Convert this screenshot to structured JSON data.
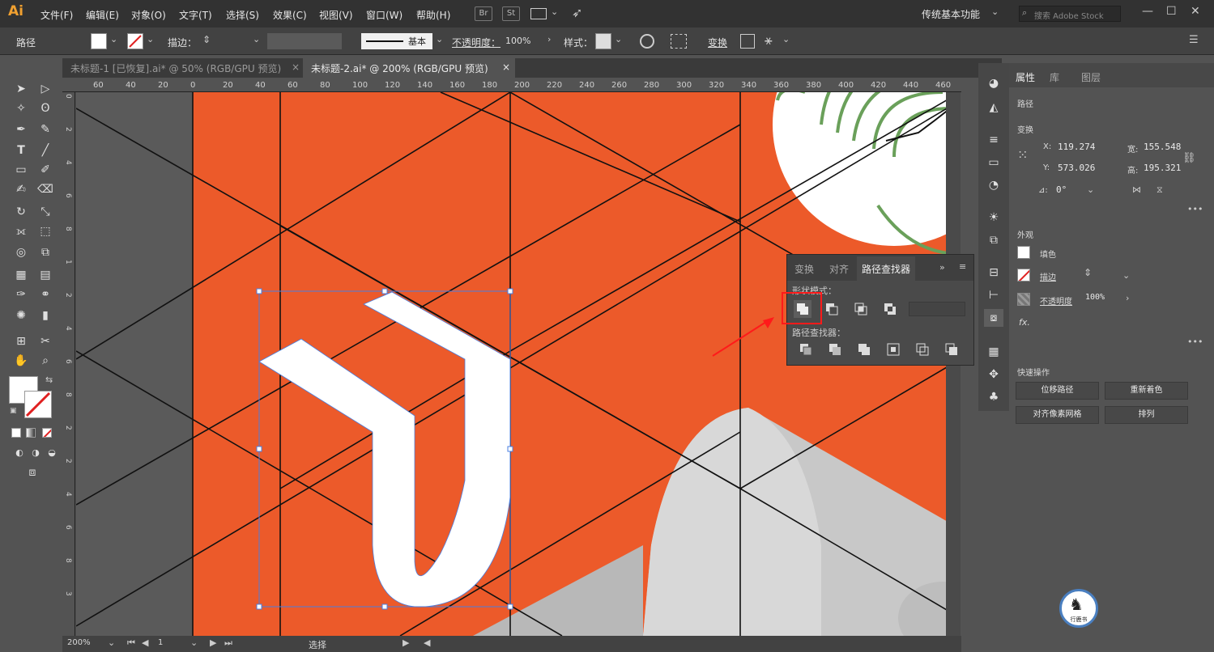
{
  "app": {
    "logo": "Ai",
    "workspace": "传统基本功能",
    "search_placeholder": "搜索 Adobe Stock"
  },
  "menu": [
    "文件(F)",
    "编辑(E)",
    "对象(O)",
    "文字(T)",
    "选择(S)",
    "效果(C)",
    "视图(V)",
    "窗口(W)",
    "帮助(H)"
  ],
  "menubar_buttons": [
    "Br",
    "St"
  ],
  "control": {
    "object_type": "路径",
    "stroke_label": "描边：",
    "stroke_style": "基本",
    "opacity_label": "不透明度：",
    "opacity_value": "100%",
    "style_label": "样式：",
    "transform_label": "变换"
  },
  "tabs": [
    {
      "label": "未标题-1 [已恢复].ai* @ 50% (RGB/GPU 预览)",
      "close": "×"
    },
    {
      "label": "未标题-2.ai* @ 200% (RGB/GPU 预览)",
      "close": "×"
    }
  ],
  "ruler_h": [
    "60",
    "40",
    "20",
    "0",
    "20",
    "40",
    "60",
    "80",
    "100",
    "120",
    "140",
    "160",
    "180",
    "200",
    "220",
    "240",
    "260",
    "280",
    "300",
    "320",
    "340",
    "360",
    "380",
    "400",
    "420",
    "440",
    "460"
  ],
  "ruler_v": [
    "0",
    "2",
    "4",
    "6",
    "8",
    "1",
    "2",
    "4",
    "6",
    "8",
    "2",
    "2",
    "4",
    "6",
    "8",
    "3"
  ],
  "pathfinder": {
    "tabs": [
      "变换",
      "对齐",
      "路径查找器"
    ],
    "shape_modes": "形状模式：",
    "pathfinders": "路径查找器："
  },
  "properties": {
    "tabs": [
      "属性",
      "库",
      "图层"
    ],
    "object": "路径",
    "transform_title": "变换",
    "x_label": "X:",
    "x": "119.274",
    "y_label": "Y:",
    "y": "573.026",
    "w_label": "宽:",
    "w": "155.548",
    "h_label": "高:",
    "h": "195.321",
    "angle_label": "⊿:",
    "angle": "0°",
    "appearance_title": "外观",
    "fill_label": "填色",
    "stroke_label": "描边",
    "opacity_label": "不透明度",
    "opacity": "100%",
    "fx": "fx.",
    "quick_title": "快速操作",
    "quick_actions": [
      "位移路径",
      "重新着色",
      "对齐像素网格",
      "排列"
    ]
  },
  "status": {
    "zoom": "200%",
    "artboard": "1",
    "mode": "选择"
  },
  "badge_text": "行鹿书",
  "colors": {
    "artboard": "#ec5a2a",
    "accent_highlight": "#ff0000",
    "green_stroke": "#6aa05a",
    "selection": "#4a7fe0"
  }
}
